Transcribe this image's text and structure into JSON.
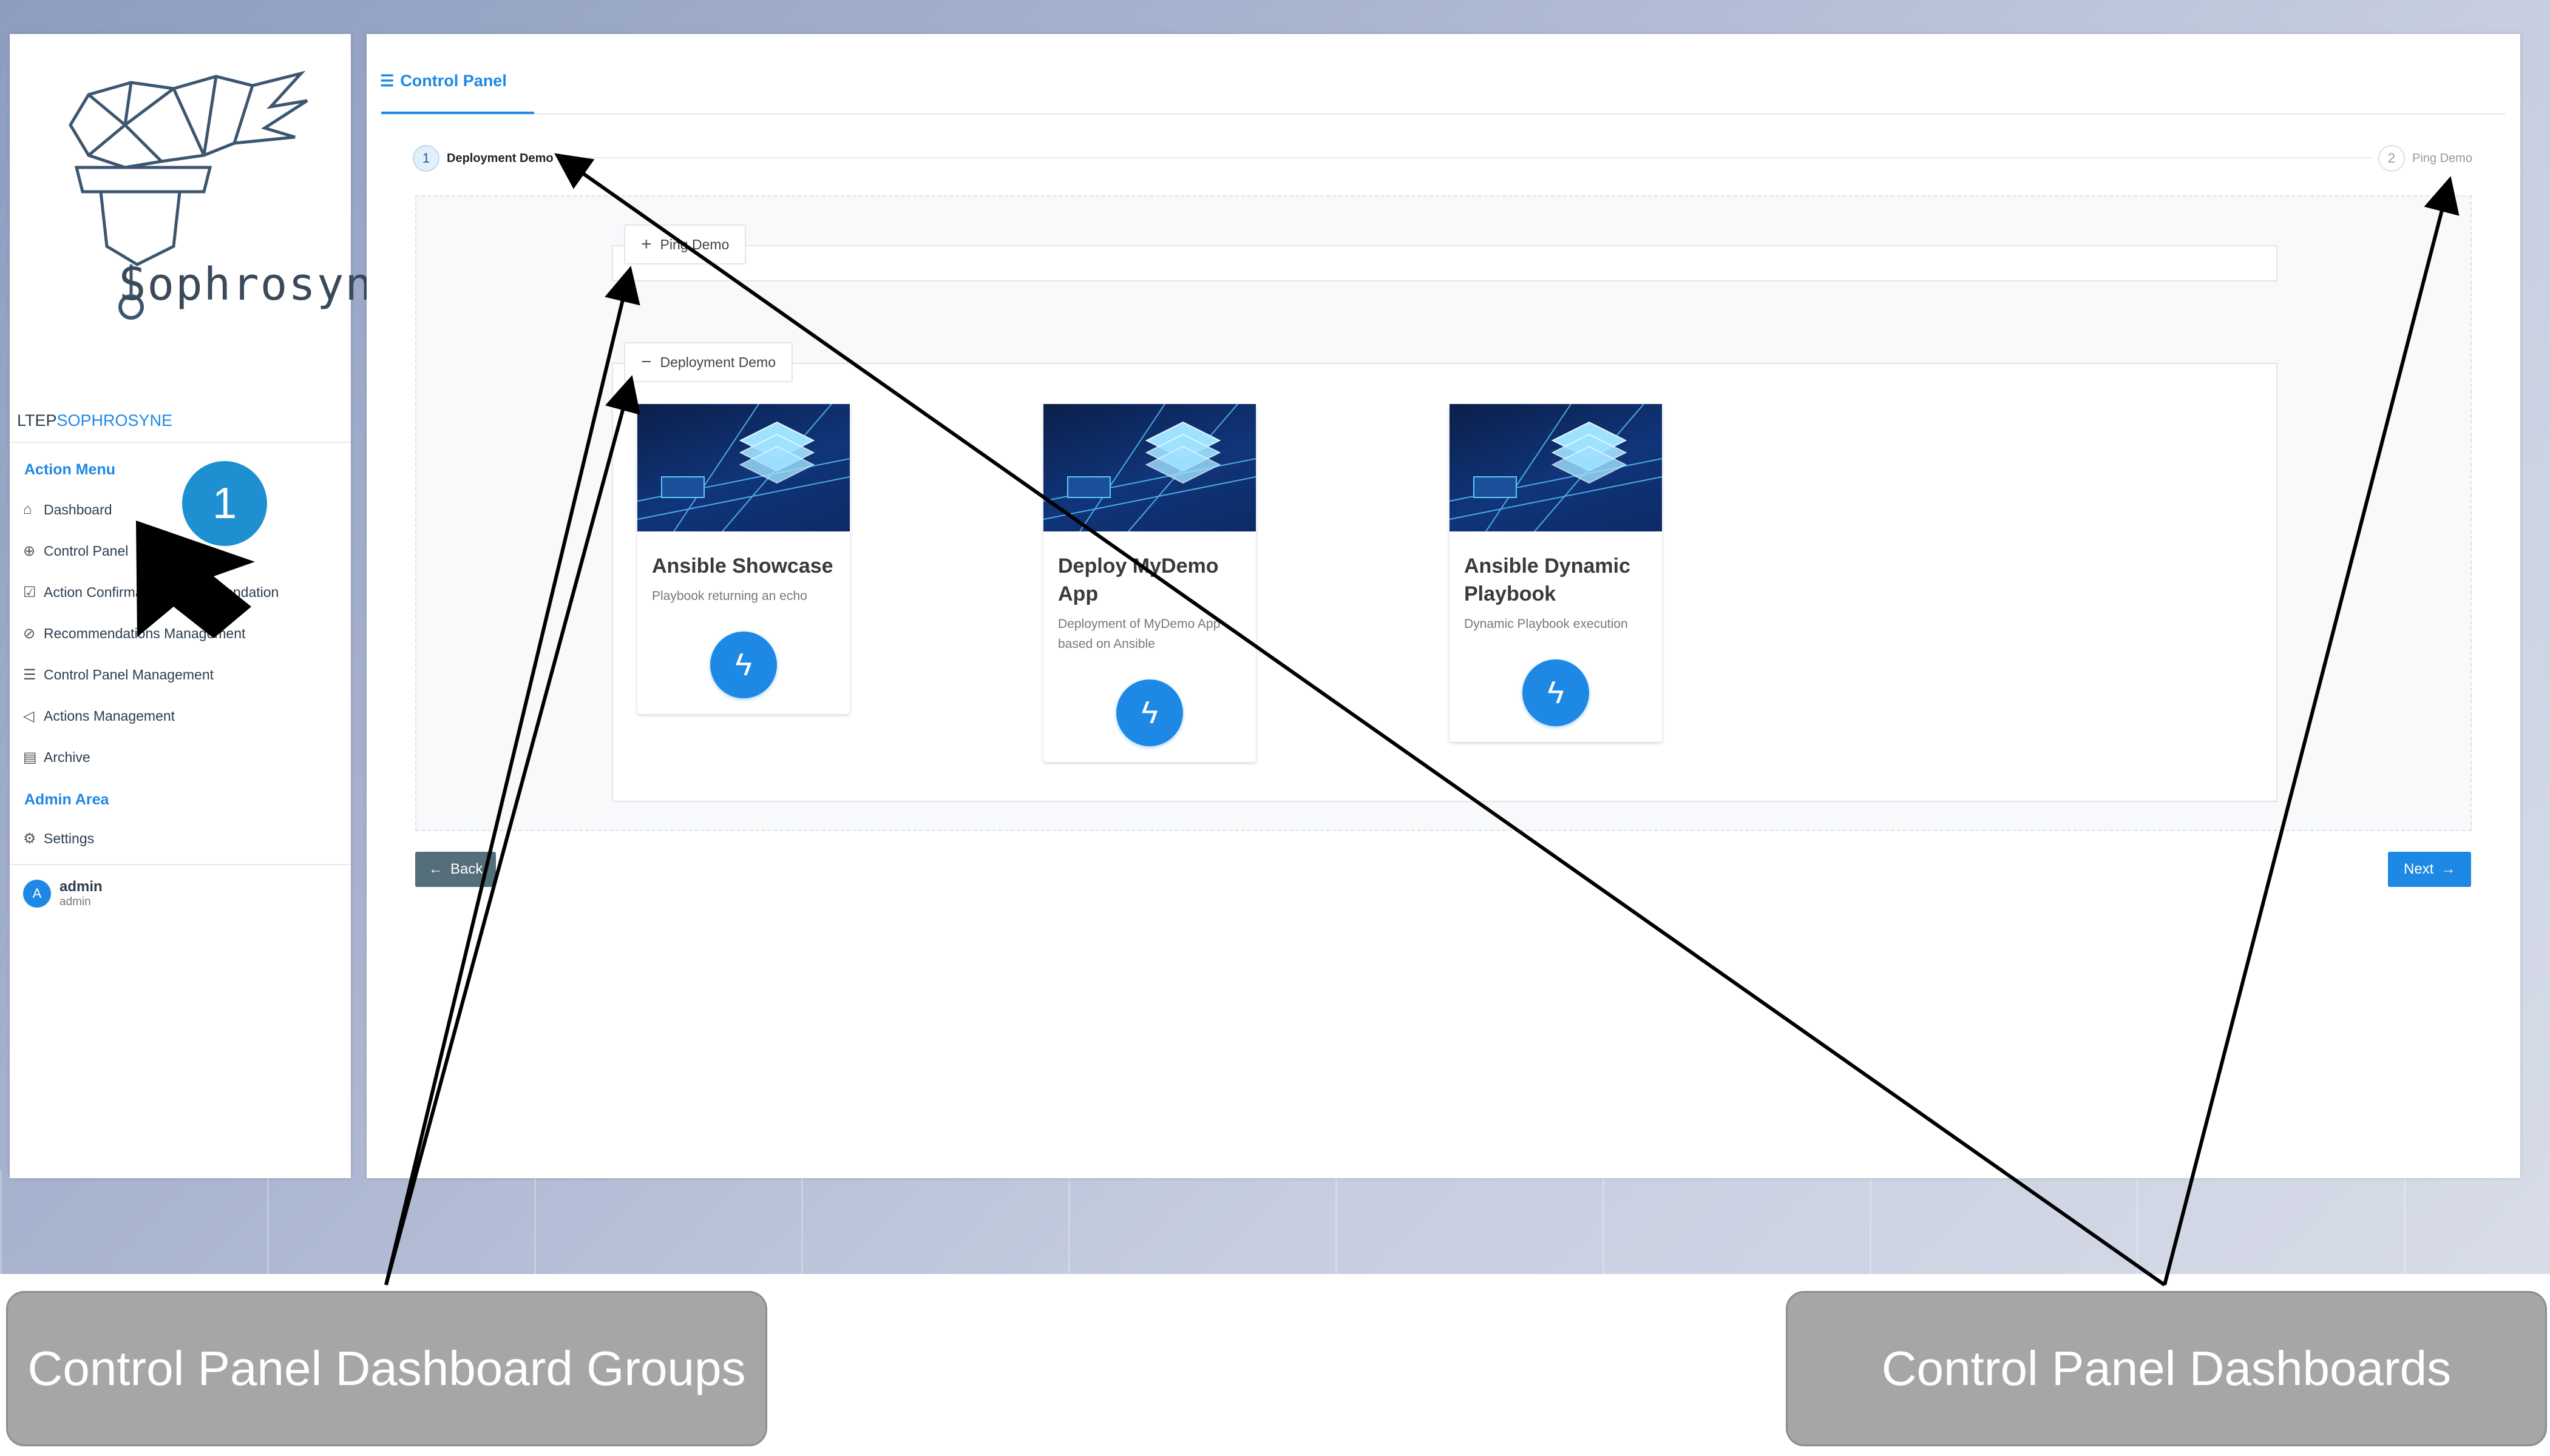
{
  "sidebar": {
    "brand_prefix": "LTEP",
    "brand_suffix": "SOPHROSYNE",
    "logo_text": "Sophrosyne",
    "section_action": "Action Menu",
    "items": [
      {
        "label": "Dashboard",
        "icon": "home-icon"
      },
      {
        "label": "Control Panel",
        "icon": "globe-icon"
      },
      {
        "label": "Action Confirmation Recommendation",
        "icon": "checkbox-icon"
      },
      {
        "label": "Recommendations Management",
        "icon": "compass-icon"
      },
      {
        "label": "Control Panel Management",
        "icon": "sliders-icon"
      },
      {
        "label": "Actions Management",
        "icon": "megaphone-icon"
      },
      {
        "label": "Archive",
        "icon": "document-icon"
      }
    ],
    "section_admin": "Admin Area",
    "settings_label": "Settings",
    "user": {
      "initial": "A",
      "name": "admin",
      "role": "admin"
    }
  },
  "main": {
    "tab_label": "Control Panel",
    "steps": [
      {
        "number": "1",
        "label": "Deployment Demo"
      },
      {
        "number": "2",
        "label": "Ping Demo"
      }
    ],
    "groups": {
      "ping": "Ping Demo",
      "deployment": "Deployment Demo"
    },
    "cards": [
      {
        "title": "Ansible Showcase",
        "description": "Playbook returning an echo"
      },
      {
        "title": "Deploy MyDemo App",
        "description": "Deployment of MyDemo App based on Ansible"
      },
      {
        "title": "Ansible Dynamic Playbook",
        "description": "Dynamic Playbook execution"
      }
    ],
    "back_label": "Back",
    "next_label": "Next"
  },
  "annotations": {
    "callout_number": "1",
    "left_caption": "Control Panel Dashboard Groups",
    "right_caption": "Control Panel Dashboards"
  },
  "colors": {
    "accent": "#1e88e5",
    "caption_bg": "#a6a6a6",
    "back_button": "#546e7a"
  }
}
